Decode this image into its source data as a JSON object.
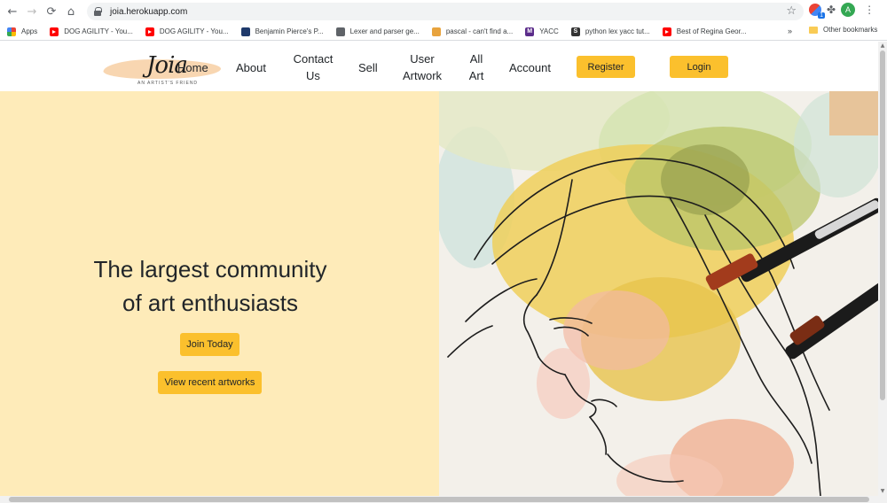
{
  "browser": {
    "url": "joia.herokuapp.com",
    "avatar_initial": "A",
    "extension_badge": "1",
    "bookmarks": [
      {
        "label": "Apps",
        "icon": "apps-grid-icon"
      },
      {
        "label": "DOG AGILITY - You...",
        "icon": "youtube-icon"
      },
      {
        "label": "DOG AGILITY - You...",
        "icon": "youtube-icon"
      },
      {
        "label": "Benjamin Pierce's P...",
        "icon": "penn-shield-icon"
      },
      {
        "label": "Lexer and parser ge...",
        "icon": "globe-icon"
      },
      {
        "label": "pascal - can't find a...",
        "icon": "stackoverflow-icon"
      },
      {
        "label": "YACC",
        "icon": "m-icon",
        "glyph": "M"
      },
      {
        "label": "python lex yacc tut...",
        "icon": "s-icon",
        "glyph": "S"
      },
      {
        "label": "Best of Regina Geor...",
        "icon": "youtube-icon"
      }
    ],
    "bookmarks_overflow": "»",
    "other_bookmarks": "Other bookmarks"
  },
  "site": {
    "logo": {
      "text": "Joia",
      "tagline": "AN ARTIST'S FRIEND"
    },
    "nav": {
      "home": "Home",
      "about": "About",
      "contact_line1": "Contact",
      "contact_line2": "Us",
      "sell": "Sell",
      "user_artwork_line1": "User",
      "user_artwork_line2": "Artwork",
      "all_art_line1": "All",
      "all_art_line2": "Art",
      "account": "Account",
      "register": "Register",
      "login": "Login"
    },
    "hero": {
      "headline_line1": "The largest community",
      "headline_line2": "of art enthusiasts",
      "join_button": "Join Today",
      "recent_button": "View recent artworks",
      "image": "watercolor-portrait-with-brushes"
    },
    "colors": {
      "accent": "#fbc02d",
      "hero_background": "#feebb9",
      "logo_swash": "#f7d1a8"
    }
  }
}
